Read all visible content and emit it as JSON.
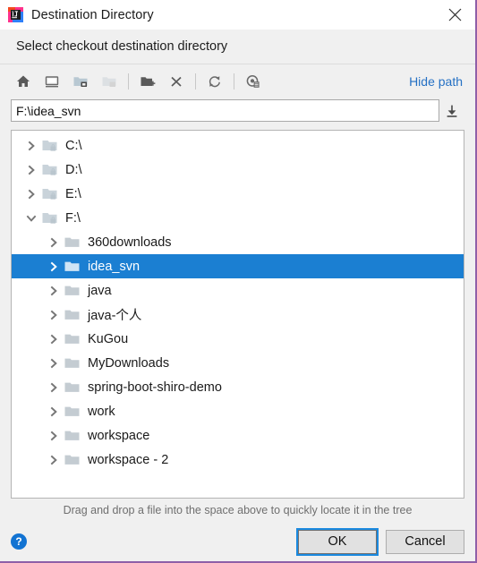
{
  "window": {
    "title": "Destination Directory",
    "app_icon": "intellij-idea-icon",
    "close_label": "close-icon",
    "border_color": "#8f5fa8"
  },
  "header": {
    "title": "Select checkout destination directory"
  },
  "toolbar": {
    "buttons": [
      {
        "name": "home-icon",
        "tooltip": "Home",
        "disabled": false
      },
      {
        "name": "desktop-icon",
        "tooltip": "Desktop",
        "disabled": false
      },
      {
        "name": "project-folder-icon",
        "tooltip": "Project",
        "disabled": false
      },
      {
        "name": "module-folder-icon",
        "tooltip": "Module",
        "disabled": true
      },
      {
        "name": "new-folder-icon",
        "tooltip": "New Folder",
        "disabled": false
      },
      {
        "name": "delete-icon",
        "tooltip": "Delete",
        "disabled": false
      },
      {
        "name": "refresh-icon",
        "tooltip": "Refresh",
        "disabled": false
      },
      {
        "name": "show-hidden-files-icon",
        "tooltip": "Show Hidden Files",
        "disabled": false
      }
    ],
    "hide_path_label": "Hide path",
    "hide_path_color": "#2470c4"
  },
  "path": {
    "value": "F:\\idea_svn",
    "placeholder": "",
    "dropdown_icon": "download-arrow-icon"
  },
  "tree": {
    "selection_color": "#1b7fd2",
    "items": [
      {
        "label": "C:\\",
        "indent": 0,
        "expanded": false,
        "selected": false,
        "icon": "drive-folder-icon"
      },
      {
        "label": "D:\\",
        "indent": 0,
        "expanded": false,
        "selected": false,
        "icon": "drive-folder-icon"
      },
      {
        "label": "E:\\",
        "indent": 0,
        "expanded": false,
        "selected": false,
        "icon": "drive-folder-icon"
      },
      {
        "label": "F:\\",
        "indent": 0,
        "expanded": true,
        "selected": false,
        "icon": "drive-folder-icon"
      },
      {
        "label": "360downloads",
        "indent": 1,
        "expanded": false,
        "selected": false,
        "icon": "folder-icon"
      },
      {
        "label": "idea_svn",
        "indent": 1,
        "expanded": false,
        "selected": true,
        "icon": "folder-icon"
      },
      {
        "label": "java",
        "indent": 1,
        "expanded": false,
        "selected": false,
        "icon": "folder-icon"
      },
      {
        "label": "java-个人",
        "indent": 1,
        "expanded": false,
        "selected": false,
        "icon": "folder-icon"
      },
      {
        "label": "KuGou",
        "indent": 1,
        "expanded": false,
        "selected": false,
        "icon": "folder-icon"
      },
      {
        "label": "MyDownloads",
        "indent": 1,
        "expanded": false,
        "selected": false,
        "icon": "folder-icon"
      },
      {
        "label": "spring-boot-shiro-demo",
        "indent": 1,
        "expanded": false,
        "selected": false,
        "icon": "folder-icon"
      },
      {
        "label": "work",
        "indent": 1,
        "expanded": false,
        "selected": false,
        "icon": "folder-icon"
      },
      {
        "label": "workspace",
        "indent": 1,
        "expanded": false,
        "selected": false,
        "icon": "folder-icon"
      },
      {
        "label": "workspace - 2",
        "indent": 1,
        "expanded": false,
        "selected": false,
        "icon": "folder-icon"
      }
    ]
  },
  "hint": {
    "text": "Drag and drop a file into the space above to quickly locate it in the tree"
  },
  "footer": {
    "help_label": "?",
    "ok_label": "OK",
    "cancel_label": "Cancel"
  }
}
